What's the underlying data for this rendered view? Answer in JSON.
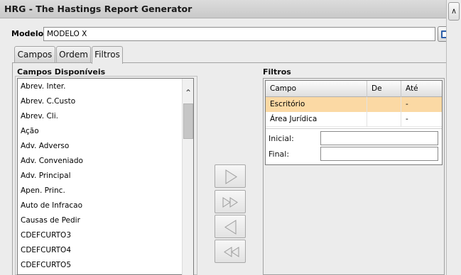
{
  "window": {
    "title": "HRG - The Hastings Report Generator"
  },
  "modelo": {
    "label": "Modelo:",
    "value": "MODELO X"
  },
  "tabs": [
    {
      "label": "Campos",
      "active": false
    },
    {
      "label": "Ordem",
      "active": false
    },
    {
      "label": "Filtros",
      "active": true
    }
  ],
  "campos_disponiveis": {
    "label": "Campos Disponíveis",
    "items": [
      "Abrev.  Inter.",
      "Abrev. C.Custo",
      "Abrev. Cli.",
      "Ação",
      "Adv. Adverso",
      "Adv. Conveniado",
      "Adv. Principal",
      "Apen. Princ.",
      "Auto de Infracao",
      "Causas de Pedir",
      "CDEFCURTO3",
      "CDEFCURTO4",
      "CDEFCURTO5"
    ]
  },
  "move_buttons": {
    "add": "arrow-right-icon",
    "add_all": "double-arrow-right-icon",
    "remove": "arrow-left-icon",
    "remove_all": "double-arrow-left-icon"
  },
  "filtros": {
    "label": "Filtros",
    "columns": [
      "Campo",
      "De",
      "Até"
    ],
    "rows": [
      {
        "campo": "Escritório",
        "de": "",
        "ate": "-",
        "selected": true
      },
      {
        "campo": "Área Jurídica",
        "de": "",
        "ate": "-",
        "selected": false
      }
    ],
    "inicial_label": "Inicial:",
    "inicial_value": "",
    "final_label": "Final:",
    "final_value": ""
  },
  "colors": {
    "selected_row": "#fbd9a4",
    "titlebar": "#d3d3d3",
    "background": "#ececec",
    "save_icon": "#2d5fa8"
  }
}
